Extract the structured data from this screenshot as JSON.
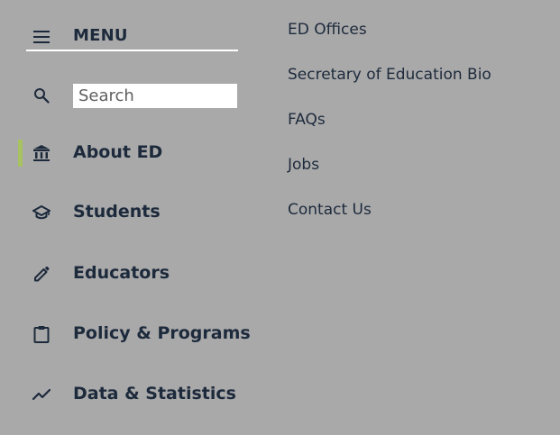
{
  "menu": {
    "title": "MENU",
    "icon": "hamburger-menu-icon"
  },
  "search": {
    "placeholder": "Search",
    "value": "",
    "icon": "search-icon"
  },
  "nav": {
    "items": [
      {
        "label": "About ED",
        "icon": "building-columns-icon",
        "active": true
      },
      {
        "label": "Students",
        "icon": "graduation-cap-icon",
        "active": false
      },
      {
        "label": "Educators",
        "icon": "pencil-icon",
        "active": false
      },
      {
        "label": "Policy & Programs",
        "icon": "clipboard-icon",
        "active": false
      },
      {
        "label": "Data & Statistics",
        "icon": "trend-line-icon",
        "active": false
      }
    ]
  },
  "submenu": {
    "items": [
      {
        "label": "ED Offices"
      },
      {
        "label": "Secretary of Education Bio"
      },
      {
        "label": "FAQs"
      },
      {
        "label": "Jobs"
      },
      {
        "label": "Contact Us"
      }
    ]
  },
  "colors": {
    "background": "#a9a9a9",
    "text": "#1d2a3c",
    "active_indicator": "#a8c262",
    "divider": "#ffffff"
  }
}
